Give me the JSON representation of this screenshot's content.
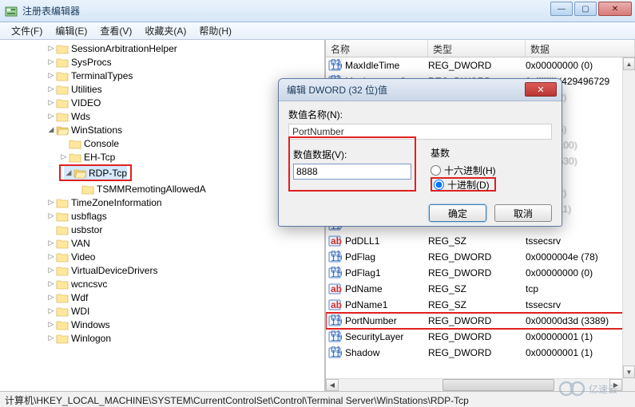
{
  "window": {
    "title": "注册表编辑器",
    "controls": {
      "min": "—",
      "max": "▢",
      "close": "✕"
    }
  },
  "menu": {
    "file": "文件(F)",
    "edit": "编辑(E)",
    "view": "查看(V)",
    "favorites": "收藏夹(A)",
    "help": "帮助(H)"
  },
  "tree": [
    {
      "level": 1,
      "exp": "▷",
      "label": "SessionArbitrationHelper",
      "open": false
    },
    {
      "level": 1,
      "exp": "▷",
      "label": "SysProcs",
      "open": false
    },
    {
      "level": 1,
      "exp": "▷",
      "label": "TerminalTypes",
      "open": false
    },
    {
      "level": 1,
      "exp": "▷",
      "label": "Utilities",
      "open": false
    },
    {
      "level": 1,
      "exp": "▷",
      "label": "VIDEO",
      "open": false
    },
    {
      "level": 1,
      "exp": "▷",
      "label": "Wds",
      "open": false
    },
    {
      "level": 1,
      "exp": "◢",
      "label": "WinStations",
      "open": true
    },
    {
      "level": 2,
      "exp": "",
      "label": "Console",
      "open": false
    },
    {
      "level": 2,
      "exp": "▷",
      "label": "EH-Tcp",
      "open": false
    },
    {
      "level": 2,
      "exp": "◢",
      "label": "RDP-Tcp",
      "open": true,
      "boxed": true,
      "sel": true
    },
    {
      "level": 3,
      "exp": "",
      "label": "TSMMRemotingAllowedA",
      "open": false
    },
    {
      "level": 1,
      "exp": "▷",
      "label": "TimeZoneInformation",
      "open": false
    },
    {
      "level": 1,
      "exp": "▷",
      "label": "usbflags",
      "open": false
    },
    {
      "level": 1,
      "exp": "",
      "label": "usbstor",
      "open": false
    },
    {
      "level": 1,
      "exp": "▷",
      "label": "VAN",
      "open": false
    },
    {
      "level": 1,
      "exp": "▷",
      "label": "Video",
      "open": false
    },
    {
      "level": 1,
      "exp": "▷",
      "label": "VirtualDeviceDrivers",
      "open": false
    },
    {
      "level": 1,
      "exp": "▷",
      "label": "wcncsvc",
      "open": false
    },
    {
      "level": 1,
      "exp": "▷",
      "label": "Wdf",
      "open": false
    },
    {
      "level": 1,
      "exp": "▷",
      "label": "WDI",
      "open": false
    },
    {
      "level": 1,
      "exp": "▷",
      "label": "Windows",
      "open": false
    },
    {
      "level": 1,
      "exp": "▷",
      "label": "Winlogon",
      "open": false
    }
  ],
  "list": {
    "headers": {
      "name": "名称",
      "type": "类型",
      "data": "数据"
    },
    "rows": [
      {
        "icon": "dw",
        "name": "MaxIdleTime",
        "type": "REG_DWORD",
        "data": "0x00000000 (0)"
      },
      {
        "icon": "dw",
        "name": "MaxInstanceC",
        "type": "REG_DWORD",
        "data": "0xffffffff (429496729"
      },
      {
        "icon": "dw",
        "name": "",
        "type": "",
        "data": "00002 (2)",
        "dim": true
      },
      {
        "icon": "dw",
        "name": "",
        "type": "",
        "data": "",
        "dim": true
      },
      {
        "icon": "dw",
        "name": "",
        "type": "",
        "data": "00006 (6)",
        "dim": true
      },
      {
        "icon": "dw",
        "name": "",
        "type": "",
        "data": "00064 (100)",
        "dim": true
      },
      {
        "icon": "dw",
        "name": "",
        "type": "",
        "data": "00212 (530)",
        "dim": true
      },
      {
        "icon": "dw",
        "name": "",
        "type": "",
        "data": "",
        "dim": true
      },
      {
        "icon": "dw",
        "name": "",
        "type": "",
        "data": "00002 (2)",
        "dim": true
      },
      {
        "icon": "dw",
        "name": "",
        "type": "",
        "data": "0000b (11)",
        "dim": true
      },
      {
        "icon": "dw",
        "name": "",
        "type": "",
        "data": ""
      },
      {
        "icon": "sz",
        "name": "PdDLL1",
        "type": "REG_SZ",
        "data": "tssecsrv"
      },
      {
        "icon": "dw",
        "name": "PdFlag",
        "type": "REG_DWORD",
        "data": "0x0000004e (78)"
      },
      {
        "icon": "dw",
        "name": "PdFlag1",
        "type": "REG_DWORD",
        "data": "0x00000000 (0)"
      },
      {
        "icon": "sz",
        "name": "PdName",
        "type": "REG_SZ",
        "data": "tcp"
      },
      {
        "icon": "sz",
        "name": "PdName1",
        "type": "REG_SZ",
        "data": "tssecsrv"
      },
      {
        "icon": "dw",
        "name": "PortNumber",
        "type": "REG_DWORD",
        "data": "0x00000d3d (3389)",
        "hl": true
      },
      {
        "icon": "dw",
        "name": "SecurityLayer",
        "type": "REG_DWORD",
        "data": "0x00000001 (1)"
      },
      {
        "icon": "dw",
        "name": "Shadow",
        "type": "REG_DWORD",
        "data": "0x00000001 (1)"
      }
    ]
  },
  "status": "计算机\\HKEY_LOCAL_MACHINE\\SYSTEM\\CurrentControlSet\\Control\\Terminal Server\\WinStations\\RDP-Tcp",
  "dialog": {
    "title": "编辑 DWORD (32 位)值",
    "name_label": "数值名称(N):",
    "name_value": "PortNumber",
    "data_label": "数值数据(V):",
    "data_value": "8888",
    "base_label": "基数",
    "radio_hex": "十六进制(H)",
    "radio_dec": "十进制(D)",
    "ok": "确定",
    "cancel": "取消",
    "close": "✕"
  },
  "watermark": "亿速云"
}
